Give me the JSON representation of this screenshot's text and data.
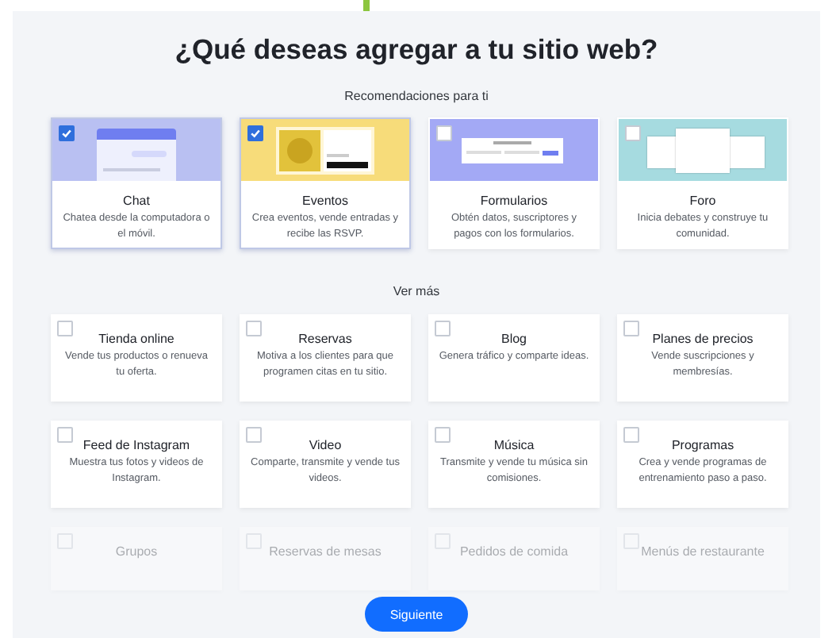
{
  "title": "¿Qué deseas agregar a tu sitio web?",
  "recommendations": {
    "heading": "Recomendaciones para ti",
    "items": [
      {
        "title": "Chat",
        "description": "Chatea desde la computadora o el móvil.",
        "checked": true,
        "color": "#b9c0f2",
        "kind": "chat"
      },
      {
        "title": "Eventos",
        "description": "Crea eventos, vende entradas y recibe las RSVP.",
        "checked": true,
        "color": "#f7dc7a",
        "kind": "events"
      },
      {
        "title": "Formularios",
        "description": "Obtén datos, suscriptores y pagos con los formularios.",
        "checked": false,
        "color": "#a3a9f5",
        "kind": "forms"
      },
      {
        "title": "Foro",
        "description": "Inicia debates y construye tu comunidad.",
        "checked": false,
        "color": "#a6dbe0",
        "kind": "forum"
      }
    ]
  },
  "more": {
    "heading": "Ver más",
    "items": [
      {
        "title": "Tienda online",
        "description": "Vende tus productos o renueva tu oferta.",
        "checked": false,
        "faded": false
      },
      {
        "title": "Reservas",
        "description": "Motiva a los clientes para que programen citas en tu sitio.",
        "checked": false,
        "faded": false
      },
      {
        "title": "Blog",
        "description": "Genera tráfico y comparte ideas.",
        "checked": false,
        "faded": false
      },
      {
        "title": "Planes de precios",
        "description": "Vende suscripciones y membresías.",
        "checked": false,
        "faded": false
      },
      {
        "title": "Feed de Instagram",
        "description": "Muestra tus fotos y videos de Instagram.",
        "checked": false,
        "faded": false
      },
      {
        "title": "Video",
        "description": "Comparte, transmite y vende tus videos.",
        "checked": false,
        "faded": false
      },
      {
        "title": "Música",
        "description": "Transmite y vende tu música sin comisiones.",
        "checked": false,
        "faded": false
      },
      {
        "title": "Programas",
        "description": "Crea y vende programas de entrenamiento paso a paso.",
        "checked": false,
        "faded": false
      },
      {
        "title": "Grupos",
        "checked": false,
        "faded": true
      },
      {
        "title": "Reservas de mesas",
        "checked": false,
        "faded": true
      },
      {
        "title": "Pedidos de comida",
        "checked": false,
        "faded": true
      },
      {
        "title": "Menús de restaurante",
        "checked": false,
        "faded": true
      }
    ]
  },
  "next_button": "Siguiente"
}
